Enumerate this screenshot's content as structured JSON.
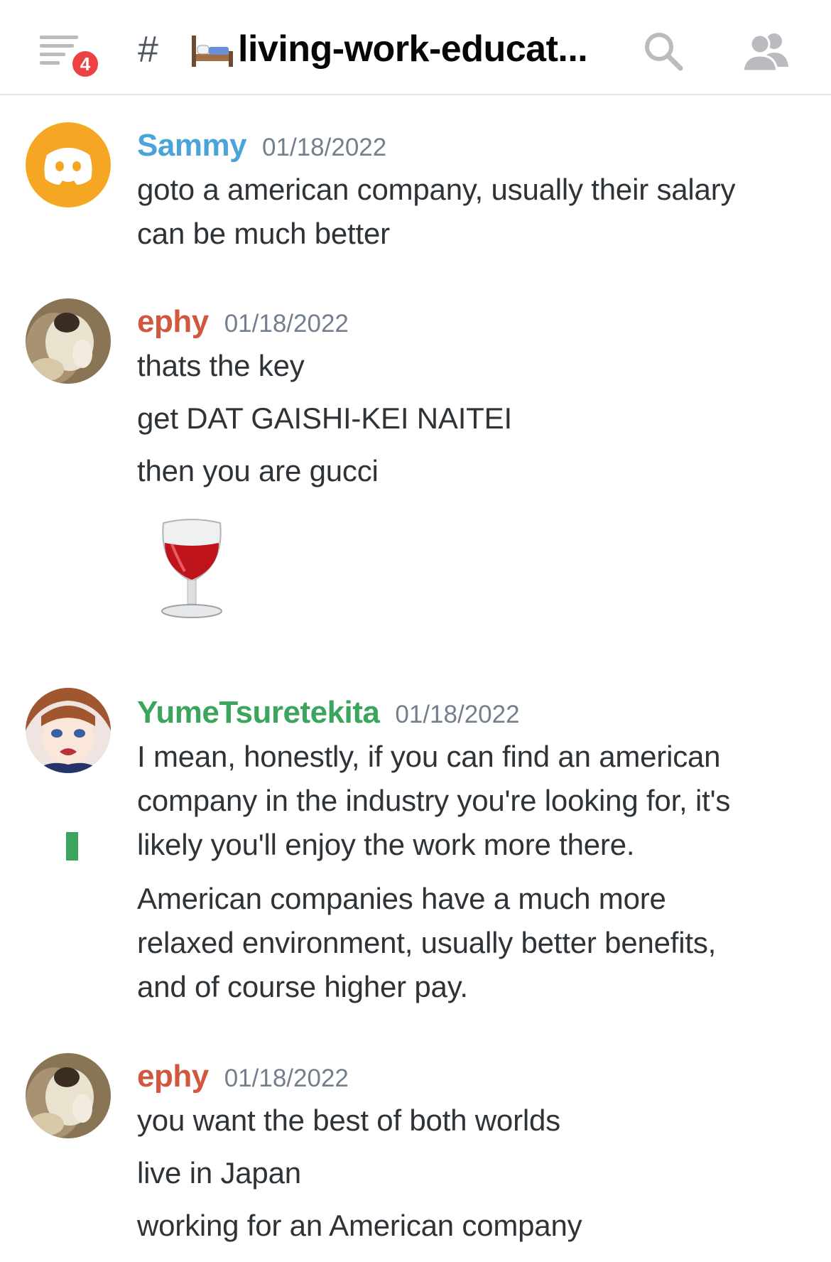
{
  "header": {
    "notification_count": "4",
    "hash_symbol": "#",
    "channel_icon": "bed-icon",
    "channel_name": "living-work-educat...",
    "icons": [
      "hamburger-menu-icon",
      "search-icon",
      "members-icon"
    ]
  },
  "colors": {
    "sammy": "#4aa3d9",
    "ephy": "#d1573e",
    "yume": "#3ba55d",
    "badge": "#ed4245",
    "timestamp": "#747f8d"
  },
  "messages": [
    {
      "author": "Sammy",
      "timestamp": "01/18/2022",
      "lines": [
        "goto a american company, usually their salary",
        "can be much better"
      ]
    },
    {
      "author": "ephy",
      "timestamp": "01/18/2022",
      "lines": [
        "thats the key",
        "get DAT GAISHI-KEI NAITEI",
        "then you are gucci"
      ],
      "emoji": "wine-glass-icon"
    },
    {
      "author": "YumeTsuretekita",
      "timestamp": "01/18/2022",
      "lines": [
        "I mean, honestly, if you can find an american",
        "company in the industry you're looking for, it's",
        "likely you'll enjoy the work more there.",
        "American companies have a much more",
        "relaxed environment, usually better benefits,",
        "and of course higher pay."
      ]
    },
    {
      "author": "ephy",
      "timestamp": "01/18/2022",
      "lines": [
        "you want the best of both worlds",
        "live in Japan",
        "working for an American company"
      ]
    }
  ]
}
